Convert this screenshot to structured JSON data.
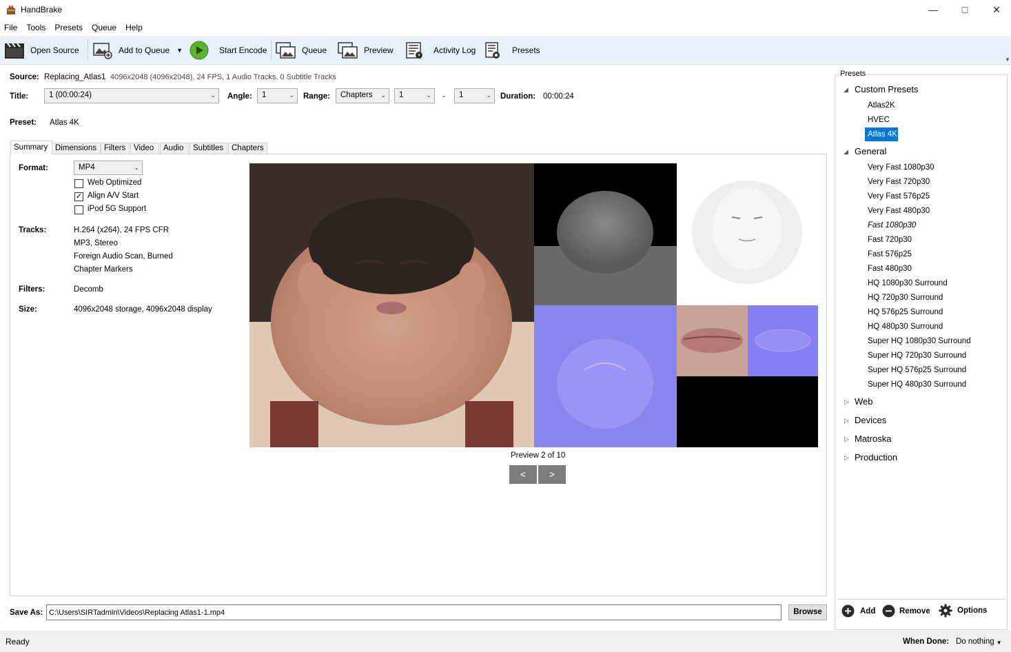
{
  "window": {
    "title": "HandBrake"
  },
  "menu": [
    "File",
    "Tools",
    "Presets",
    "Queue",
    "Help"
  ],
  "toolbar": {
    "open_source": "Open Source",
    "add_to_queue": "Add to Queue",
    "start_encode": "Start Encode",
    "queue": "Queue",
    "preview": "Preview",
    "activity_log": "Activity Log",
    "presets": "Presets"
  },
  "source": {
    "label": "Source:",
    "name": "Replacing_Atlas1",
    "info": "4096x2048 (4096x2048), 24 FPS, 1 Audio Tracks, 0 Subtitle Tracks"
  },
  "title_row": {
    "title_label": "Title:",
    "title_value": "1  (00:00:24)",
    "angle_label": "Angle:",
    "angle_value": "1",
    "range_label": "Range:",
    "range_type": "Chapters",
    "range_start": "1",
    "range_sep": "-",
    "range_end": "1",
    "duration_label": "Duration:",
    "duration_value": "00:00:24"
  },
  "preset": {
    "label": "Preset:",
    "value": "Atlas 4K"
  },
  "tabs": [
    "Summary",
    "Dimensions",
    "Filters",
    "Video",
    "Audio",
    "Subtitles",
    "Chapters"
  ],
  "summary": {
    "format_label": "Format:",
    "format_value": "MP4",
    "web_optimized": {
      "label": "Web Optimized",
      "checked": false
    },
    "align_av": {
      "label": "Align A/V Start",
      "checked": true
    },
    "ipod": {
      "label": "iPod 5G Support",
      "checked": false
    },
    "tracks_label": "Tracks:",
    "tracks": [
      "H.264 (x264), 24 FPS CFR",
      "MP3, Stereo",
      "Foreign Audio Scan, Burned",
      "Chapter Markers"
    ],
    "filters_label": "Filters:",
    "filters_value": "Decomb",
    "size_label": "Size:",
    "size_value": "4096x2048 storage, 4096x2048 display",
    "preview_caption": "Preview 2 of 10",
    "prev": "<",
    "next": ">"
  },
  "save": {
    "label": "Save As:",
    "path": "C:\\Users\\SIRTadmin\\Videos\\Replacing Atlas1-1.mp4",
    "browse": "Browse"
  },
  "presets_panel": {
    "legend": "Presets",
    "custom_group": "Custom Presets",
    "custom_items": [
      "Atlas2K",
      "HVEC",
      "Atlas 4K"
    ],
    "selected": "Atlas 4K",
    "general_group": "General",
    "general_items": [
      "Very Fast 1080p30",
      "Very Fast 720p30",
      "Very Fast 576p25",
      "Very Fast 480p30",
      "Fast 1080p30",
      "Fast 720p30",
      "Fast 576p25",
      "Fast 480p30",
      "HQ 1080p30 Surround",
      "HQ 720p30 Surround",
      "HQ 576p25 Surround",
      "HQ 480p30 Surround",
      "Super HQ 1080p30 Surround",
      "Super HQ 720p30 Surround",
      "Super HQ 576p25 Surround",
      "Super HQ 480p30 Surround"
    ],
    "collapsed_groups": [
      "Web",
      "Devices",
      "Matroska",
      "Production"
    ],
    "add": "Add",
    "remove": "Remove",
    "options": "Options"
  },
  "status": {
    "text": "Ready",
    "when_done_label": "When Done:",
    "when_done_value": "Do nothing"
  },
  "colors": {
    "toolbar_bg": "#e8f0fa",
    "selection": "#0078d7",
    "nav_button": "#7d7d7d"
  }
}
